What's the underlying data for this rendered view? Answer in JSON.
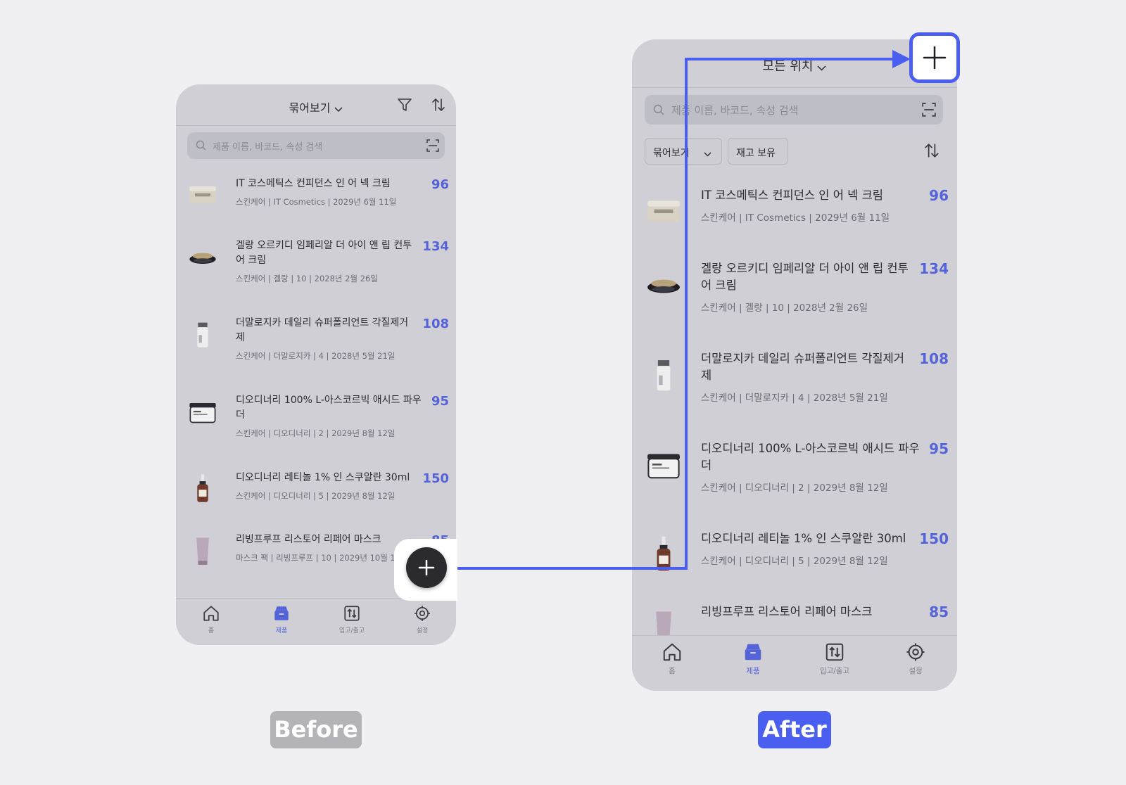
{
  "before": {
    "header": {
      "title": "묶어보기"
    },
    "search": {
      "placeholder": "제품 이름, 바코드, 속성 검색"
    },
    "products": [
      {
        "name_lines": [
          "IT 코스메틱스 컨피던스 인 어 넥 크림"
        ],
        "meta": "스킨케어 | IT Cosmetics | 2029년 6월 11일",
        "count": "96"
      },
      {
        "name_lines": [
          "겔랑 오르키디 임페리알 더 아이 앤 립 컨투",
          "어 크림"
        ],
        "meta": "스킨케어 | 겔랑 | 10 | 2028년 2월 26일",
        "count": "134"
      },
      {
        "name_lines": [
          "더말로지카 데일리 슈퍼폴리언트 각질제거",
          "제"
        ],
        "meta": "스킨케어 | 더말로지카 | 4 | 2028년 5월 21일",
        "count": "108"
      },
      {
        "name_lines": [
          "디오디너리 100% L-아스코르빅 애시드 파우",
          "더"
        ],
        "meta": "스킨케어 | 디오디너리 | 2 | 2029년 8월 12일",
        "count": "95"
      },
      {
        "name_lines": [
          "디오디너리 레티놀 1% 인 스쿠알란 30ml"
        ],
        "meta": "스킨케어 | 디오디너리 | 5 | 2029년 8월 12일",
        "count": "150"
      },
      {
        "name_lines": [
          "리빙프루프 리스토어 리페어 마스크"
        ],
        "meta": "마스크 팩 | 리빙프루프 | 10 | 2029년 10월 11일",
        "count": "85"
      }
    ],
    "tabs": [
      "홈",
      "제품",
      "입고/출고",
      "설정"
    ],
    "label": "Before"
  },
  "after": {
    "header": {
      "title": "모든 위치"
    },
    "search": {
      "placeholder": "제품 이름, 바코드, 속성 검색"
    },
    "filters": {
      "group": "묶어보기",
      "stock": "재고 보유"
    },
    "products": [
      {
        "name_lines": [
          "IT 코스메틱스 컨피던스 인 어 넥 크림"
        ],
        "meta": "스킨케어 | IT Cosmetics | 2029년 6월 11일",
        "count": "96"
      },
      {
        "name_lines": [
          "겔랑 오르키디 임페리알 더 아이 앤 립 컨투",
          "어 크림"
        ],
        "meta": "스킨케어 | 겔랑 | 10 | 2028년 2월 26일",
        "count": "134"
      },
      {
        "name_lines": [
          "더말로지카 데일리 슈퍼폴리언트 각질제거",
          "제"
        ],
        "meta": "스킨케어 | 더말로지카 | 4 | 2028년 5월 21일",
        "count": "108"
      },
      {
        "name_lines": [
          "디오디너리 100% L-아스코르빅 애시드 파우",
          "더"
        ],
        "meta": "스킨케어 | 디오디너리 | 2 | 2029년 8월 12일",
        "count": "95"
      },
      {
        "name_lines": [
          "디오디너리 레티놀 1% 인 스쿠알란 30ml"
        ],
        "meta": "스킨케어 | 디오디너리 | 5 | 2029년 8월 12일",
        "count": "150"
      },
      {
        "name_lines": [
          "리빙프루프 리스토어 리페어 마스크"
        ],
        "meta": "",
        "count": "85"
      }
    ],
    "tabs": [
      "홈",
      "제품",
      "입고/출고",
      "설정"
    ],
    "label": "After"
  },
  "colors": {
    "accent": "#4a5ef0",
    "count": "#5563d8",
    "fab": "#2b2b2f",
    "before_badge": "#b4b4b8"
  }
}
